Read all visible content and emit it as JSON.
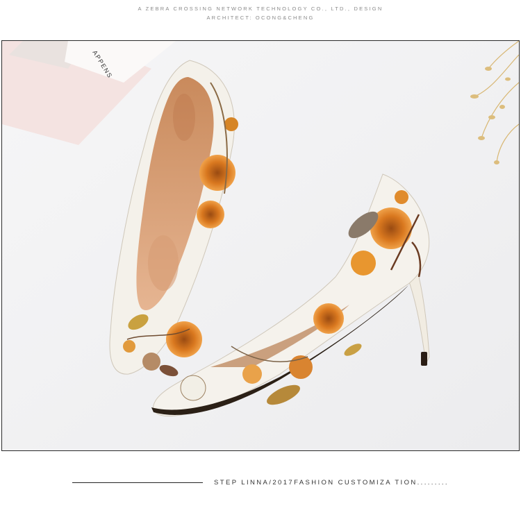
{
  "header": {
    "line1": "A ZEBRA CROSSING NETWORK TECHNOLOGY CO., LTD., DESIGN",
    "line2": "ARCHITECT: OCONG&CHENG"
  },
  "photo": {
    "card_text": "APPENS"
  },
  "footer": {
    "caption": "STEP LINNA/2017FASHION CUSTOMIZA TION........."
  }
}
